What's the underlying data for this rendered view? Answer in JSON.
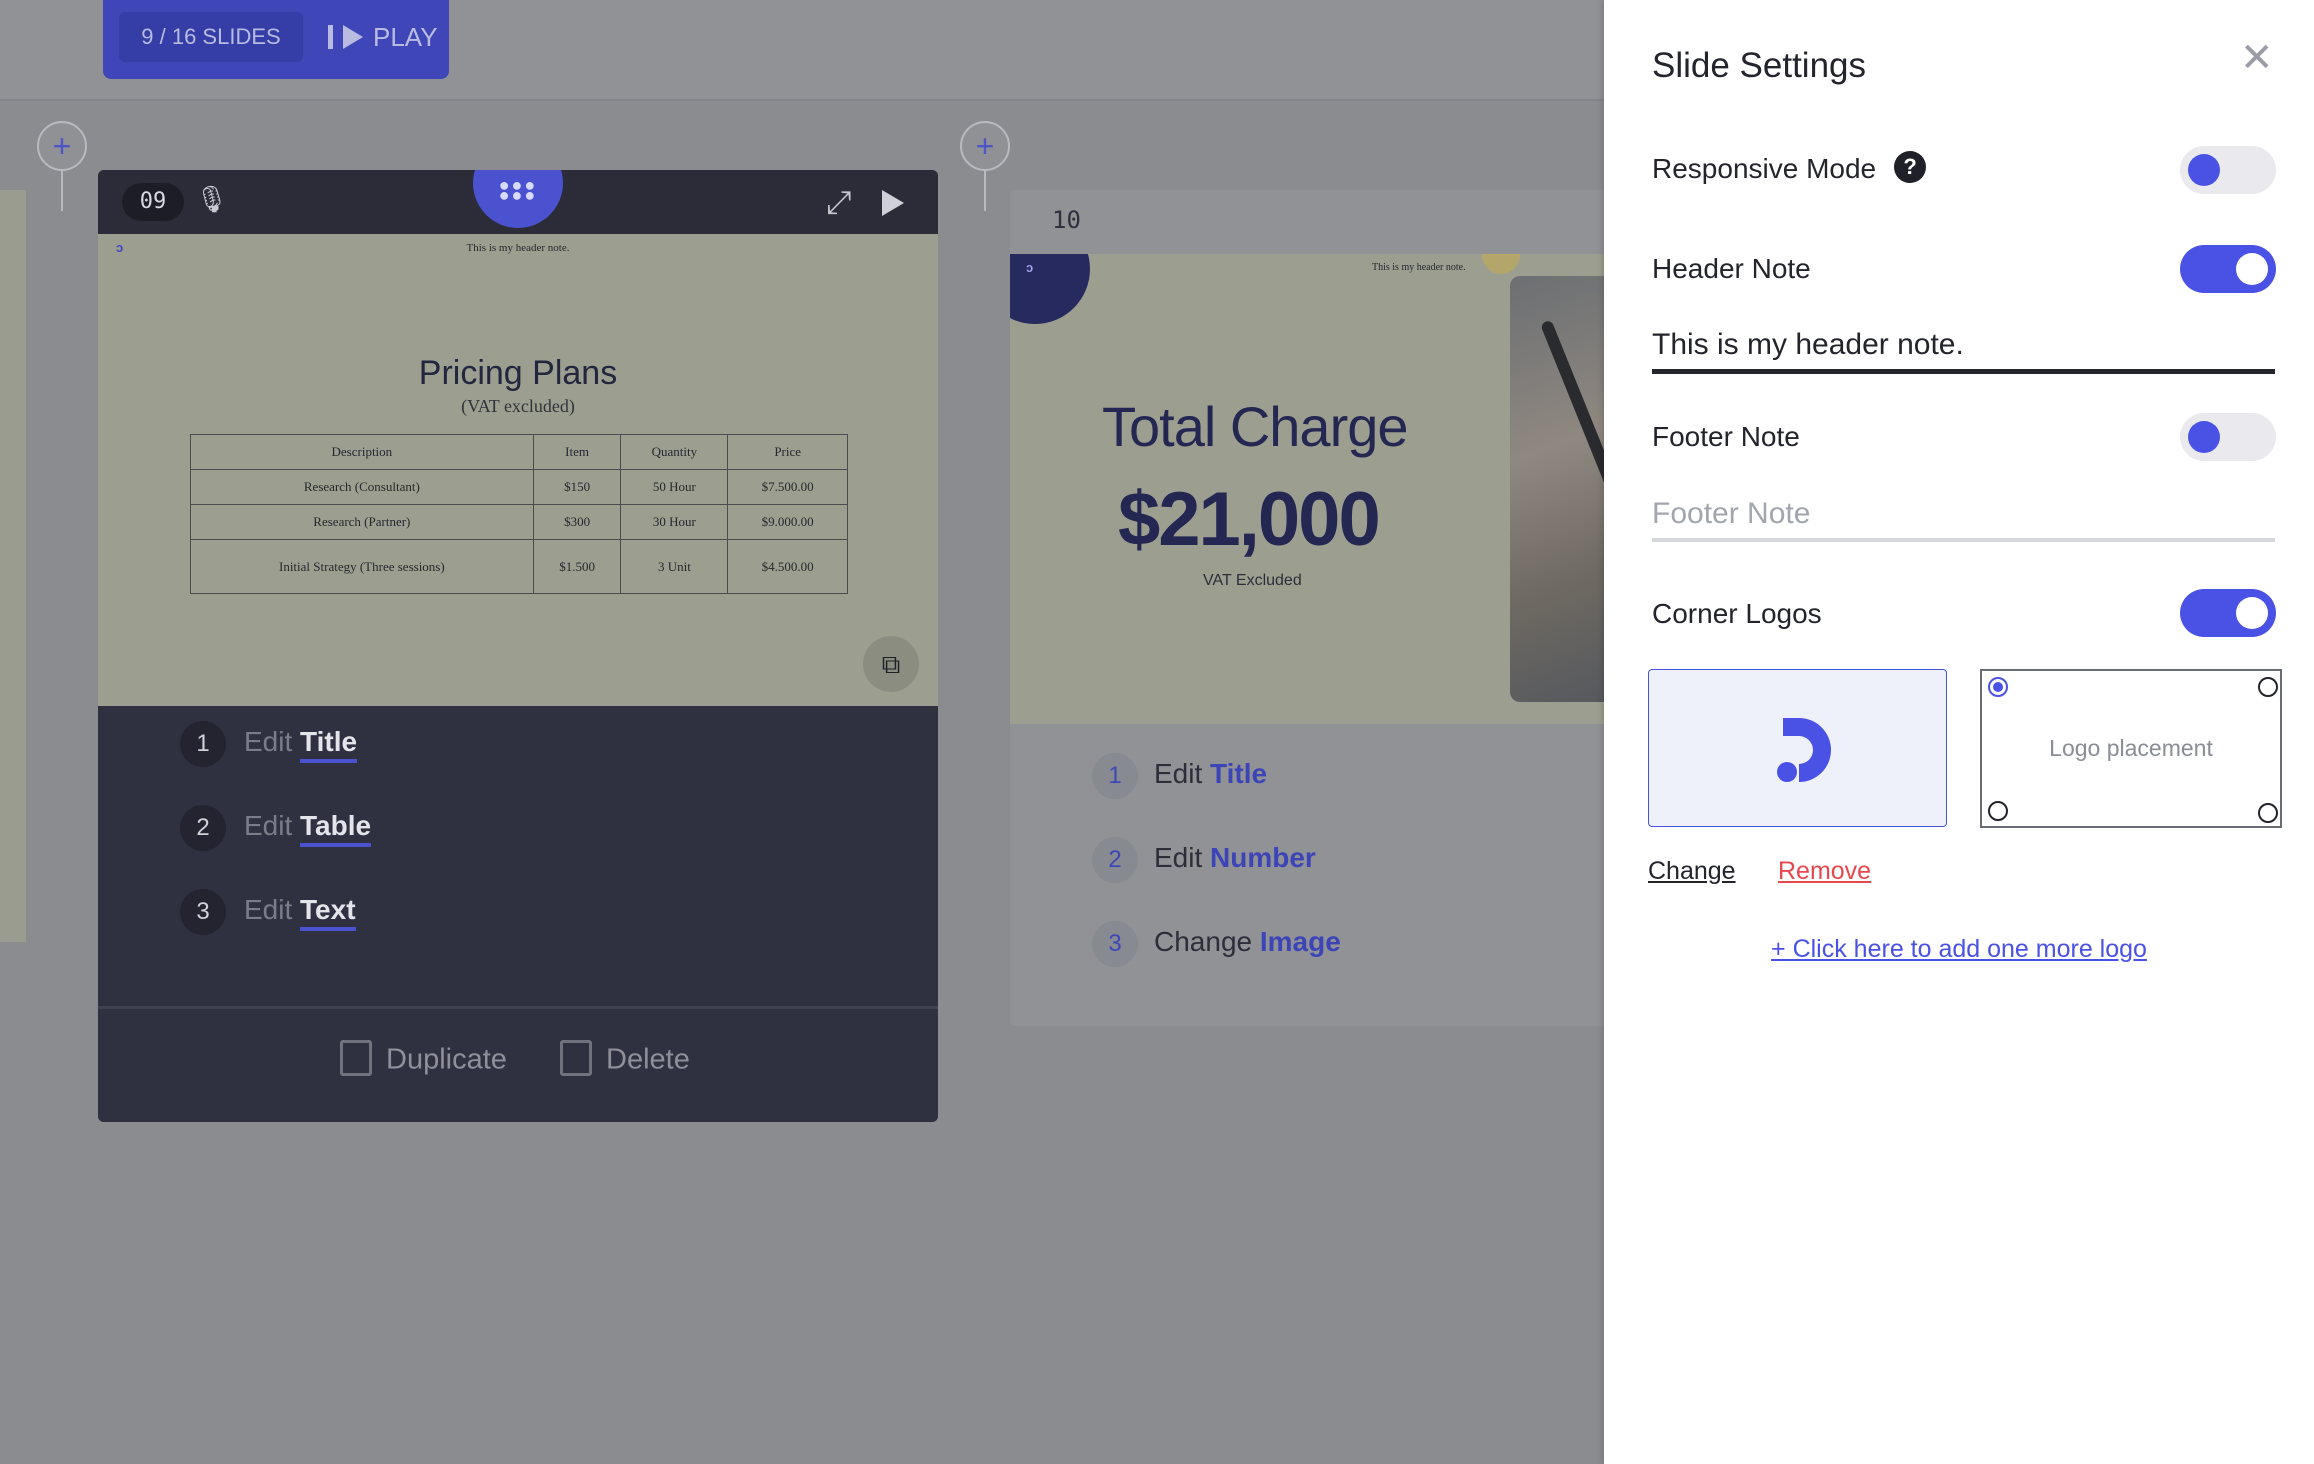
{
  "topbar": {
    "slide_count": "9 / 16 SLIDES",
    "play_label": "PLAY"
  },
  "slide9": {
    "number": "09",
    "header_note": "This is my header note.",
    "title": "Pricing Plans",
    "subtitle": "(VAT excluded)",
    "table": {
      "headers": [
        "Description",
        "Item",
        "Quantity",
        "Price"
      ],
      "rows": [
        [
          "Research (Consultant)",
          "$150",
          "50 Hour",
          "$7.500.00"
        ],
        [
          "Research (Partner)",
          "$300",
          "30 Hour",
          "$9.000.00"
        ],
        [
          "Initial Strategy (Three sessions)",
          "$1.500",
          "3 Unit",
          "$4.500.00"
        ]
      ]
    },
    "edits": [
      {
        "num": "1",
        "verb": "Edit",
        "target": "Title"
      },
      {
        "num": "2",
        "verb": "Edit",
        "target": "Table"
      },
      {
        "num": "3",
        "verb": "Edit",
        "target": "Text"
      }
    ],
    "duplicate_label": "Duplicate",
    "delete_label": "Delete"
  },
  "slide10": {
    "number": "10",
    "header_note": "This is my header note.",
    "title": "Total Charge",
    "amount": "$21,000",
    "note": "VAT Excluded",
    "edits": [
      {
        "num": "1",
        "verb": "Edit",
        "target": "Title"
      },
      {
        "num": "2",
        "verb": "Edit",
        "target": "Number"
      },
      {
        "num": "3",
        "verb": "Change",
        "target": "Image"
      }
    ]
  },
  "settings": {
    "title": "Slide Settings",
    "responsive_label": "Responsive Mode",
    "responsive_on": false,
    "header_note_label": "Header Note",
    "header_note_on": true,
    "header_note_value": "This is my header note.",
    "footer_note_label": "Footer Note",
    "footer_note_on": false,
    "footer_note_placeholder": "Footer Note",
    "corner_logos_label": "Corner Logos",
    "corner_logos_on": true,
    "logo_placement_label": "Logo placement",
    "change_label": "Change",
    "remove_label": "Remove",
    "add_logo_label": "+ Click here to add one more logo",
    "accent_color": "#4a52e6",
    "danger_color": "#e5484d"
  }
}
